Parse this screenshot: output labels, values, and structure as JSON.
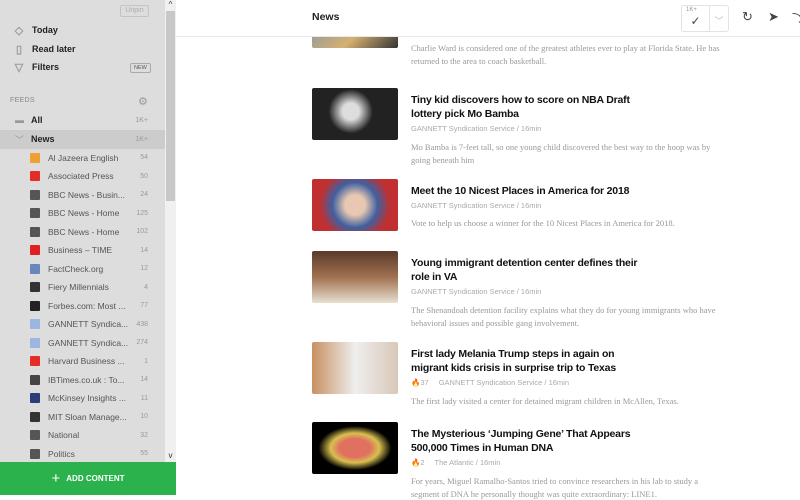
{
  "sidebar": {
    "unpin": "Unpin",
    "nav": [
      {
        "label": "Today",
        "icon": "today-icon"
      },
      {
        "label": "Read later",
        "icon": "bookmark-icon"
      },
      {
        "label": "Filters",
        "icon": "filter-icon"
      }
    ],
    "new_badge": "NEW",
    "feeds_header": "FEEDS",
    "all": {
      "label": "All",
      "count": "1K+"
    },
    "news": {
      "label": "News",
      "count": "1K+"
    },
    "feeds": [
      {
        "label": "Al Jazeera English",
        "count": "54",
        "color": "#f0a030"
      },
      {
        "label": "Associated Press",
        "count": "50",
        "color": "#e52d27"
      },
      {
        "label": "BBC News - Busin...",
        "count": "24",
        "color": "#555"
      },
      {
        "label": "BBC News - Home",
        "count": "125",
        "color": "#555"
      },
      {
        "label": "BBC News - Home",
        "count": "102",
        "color": "#555"
      },
      {
        "label": "Business – TIME",
        "count": "14",
        "color": "#e02020"
      },
      {
        "label": "FactCheck.org",
        "count": "12",
        "color": "#6688bb"
      },
      {
        "label": "Fiery Millennials",
        "count": "4",
        "color": "#333"
      },
      {
        "label": "Forbes.com: Most ...",
        "count": "77",
        "color": "#222"
      },
      {
        "label": "GANNETT Syndica...",
        "count": "438",
        "color": "#9bb6e0"
      },
      {
        "label": "GANNETT Syndica...",
        "count": "274",
        "color": "#9bb6e0"
      },
      {
        "label": "Harvard Business ...",
        "count": "1",
        "color": "#e52d27"
      },
      {
        "label": "IBTimes.co.uk : To...",
        "count": "14",
        "color": "#444"
      },
      {
        "label": "McKinsey Insights ...",
        "count": "11",
        "color": "#2a3f7a"
      },
      {
        "label": "MIT Sloan Manage...",
        "count": "10",
        "color": "#333"
      },
      {
        "label": "National",
        "count": "32",
        "color": "#555"
      },
      {
        "label": "Politics",
        "count": "55",
        "color": "#555"
      }
    ],
    "add_content": "ADD CONTENT"
  },
  "header": {
    "title": "News",
    "mark_read_count": "1K+"
  },
  "articles": [
    {
      "title": "",
      "meta": "",
      "desc": "Charlie Ward is considered one of the greatest athletes ever to play at Florida State. He has returned to the area to coach basketball."
    },
    {
      "title": "Tiny kid discovers how to score on NBA Draft lottery pick Mo Bamba",
      "engagement": "",
      "meta": "GANNETT Syndication Service / 16min",
      "desc": "Mo Bamba is 7-feet tall, so one young child discovered the best way to the hoop was by going beneath him"
    },
    {
      "title": "Meet the 10 Nicest Places in America for 2018",
      "engagement": "",
      "meta": "GANNETT Syndication Service / 16min",
      "desc": "Vote to help us choose a winner for the 10 Nicest Places in America for 2018."
    },
    {
      "title": "Young immigrant detention center defines their role in VA",
      "engagement": "",
      "meta": "GANNETT Syndication Service / 16min",
      "desc": "The Shenandoah detention facility explains what they do for young immigrants who have behavioral issues and possible gang involvement."
    },
    {
      "title": "First lady Melania Trump steps in again on migrant kids crisis in surprise trip to Texas",
      "engagement": "37",
      "meta": "GANNETT Syndication Service / 16min",
      "desc": "The first lady visited a center for detained migrant children in McAllen, Texas."
    },
    {
      "title": "The Mysterious ‘Jumping Gene’ That Appears 500,000 Times in Human DNA",
      "engagement": "2",
      "meta": "The Atlantic / 16min",
      "desc": "For years, Miguel Ramalho-Santos tried to convince researchers in his lab to study a segment of DNA he personally thought was quite extraordinary: LINE1."
    }
  ]
}
